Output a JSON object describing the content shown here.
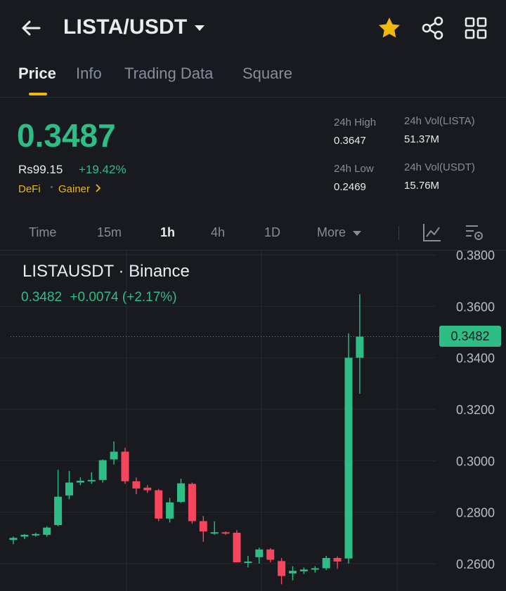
{
  "header": {
    "pair": "LISTA/USDT"
  },
  "tabs": [
    {
      "label": "Price",
      "active": true
    },
    {
      "label": "Info",
      "active": false
    },
    {
      "label": "Trading Data",
      "active": false
    },
    {
      "label": "Square",
      "active": false
    }
  ],
  "price": {
    "last": "0.3487",
    "local": "Rs99.15",
    "change": "+19.42%",
    "tag1": "DeFi",
    "tag2": "Gainer"
  },
  "stats": {
    "high_label": "24h High",
    "high": "0.3647",
    "low_label": "24h Low",
    "low": "0.2469",
    "vol_base_label": "24h Vol(LISTA)",
    "vol_base": "51.37M",
    "vol_quote_label": "24h Vol(USDT)",
    "vol_quote": "15.76M"
  },
  "timeframes": [
    {
      "label": "Time",
      "active": false
    },
    {
      "label": "15m",
      "active": false
    },
    {
      "label": "1h",
      "active": true
    },
    {
      "label": "4h",
      "active": false
    },
    {
      "label": "1D",
      "active": false
    },
    {
      "label": "More",
      "active": false
    }
  ],
  "chart": {
    "title": "LISTAUSDT · Binance",
    "last_close": "0.3482",
    "change": "+0.0074 (+2.17%)",
    "current_tag": "0.3482"
  },
  "colors": {
    "up": "#2ebd85",
    "down": "#f6465d",
    "accent": "#f0b90b"
  },
  "chart_data": {
    "type": "candlestick",
    "y_ticks": [
      "0.3800",
      "0.3600",
      "0.3400",
      "0.3200",
      "0.3000",
      "0.2800",
      "0.2600"
    ],
    "ylim": [
      0.2515,
      0.3815
    ],
    "current_price": 0.3482,
    "candles": [
      {
        "o": 0.2692,
        "h": 0.2705,
        "l": 0.2675,
        "c": 0.27
      },
      {
        "o": 0.2705,
        "h": 0.2715,
        "l": 0.2695,
        "c": 0.2712
      },
      {
        "o": 0.2712,
        "h": 0.272,
        "l": 0.2705,
        "c": 0.2715
      },
      {
        "o": 0.2712,
        "h": 0.2745,
        "l": 0.2705,
        "c": 0.274
      },
      {
        "o": 0.275,
        "h": 0.2965,
        "l": 0.2745,
        "c": 0.286
      },
      {
        "o": 0.2865,
        "h": 0.296,
        "l": 0.285,
        "c": 0.2915
      },
      {
        "o": 0.2915,
        "h": 0.2935,
        "l": 0.2905,
        "c": 0.2922
      },
      {
        "o": 0.292,
        "h": 0.2955,
        "l": 0.291,
        "c": 0.2925
      },
      {
        "o": 0.2925,
        "h": 0.3005,
        "l": 0.2915,
        "c": 0.3002
      },
      {
        "o": 0.3005,
        "h": 0.3075,
        "l": 0.2985,
        "c": 0.3035
      },
      {
        "o": 0.3035,
        "h": 0.305,
        "l": 0.291,
        "c": 0.292
      },
      {
        "o": 0.292,
        "h": 0.2935,
        "l": 0.287,
        "c": 0.2892
      },
      {
        "o": 0.2895,
        "h": 0.2905,
        "l": 0.2875,
        "c": 0.2885
      },
      {
        "o": 0.2885,
        "h": 0.289,
        "l": 0.2765,
        "c": 0.2775
      },
      {
        "o": 0.2775,
        "h": 0.2855,
        "l": 0.276,
        "c": 0.2838
      },
      {
        "o": 0.284,
        "h": 0.293,
        "l": 0.2835,
        "c": 0.2912
      },
      {
        "o": 0.291,
        "h": 0.2915,
        "l": 0.2755,
        "c": 0.2765
      },
      {
        "o": 0.2765,
        "h": 0.2785,
        "l": 0.2685,
        "c": 0.2725
      },
      {
        "o": 0.272,
        "h": 0.2765,
        "l": 0.2712,
        "c": 0.2722
      },
      {
        "o": 0.2722,
        "h": 0.2725,
        "l": 0.2712,
        "c": 0.2717
      },
      {
        "o": 0.272,
        "h": 0.273,
        "l": 0.2615,
        "c": 0.2605
      },
      {
        "o": 0.2605,
        "h": 0.263,
        "l": 0.2585,
        "c": 0.2608
      },
      {
        "o": 0.2625,
        "h": 0.2662,
        "l": 0.26,
        "c": 0.2655
      },
      {
        "o": 0.2655,
        "h": 0.266,
        "l": 0.2605,
        "c": 0.2615
      },
      {
        "o": 0.261,
        "h": 0.2622,
        "l": 0.252,
        "c": 0.2552
      },
      {
        "o": 0.2562,
        "h": 0.259,
        "l": 0.2535,
        "c": 0.2572
      },
      {
        "o": 0.257,
        "h": 0.2585,
        "l": 0.256,
        "c": 0.2577
      },
      {
        "o": 0.2577,
        "h": 0.259,
        "l": 0.2565,
        "c": 0.2582
      },
      {
        "o": 0.2582,
        "h": 0.263,
        "l": 0.2575,
        "c": 0.2622
      },
      {
        "o": 0.2622,
        "h": 0.2628,
        "l": 0.258,
        "c": 0.2608
      },
      {
        "o": 0.262,
        "h": 0.3495,
        "l": 0.26,
        "c": 0.34
      },
      {
        "o": 0.34,
        "h": 0.3647,
        "l": 0.326,
        "c": 0.3482
      }
    ]
  }
}
